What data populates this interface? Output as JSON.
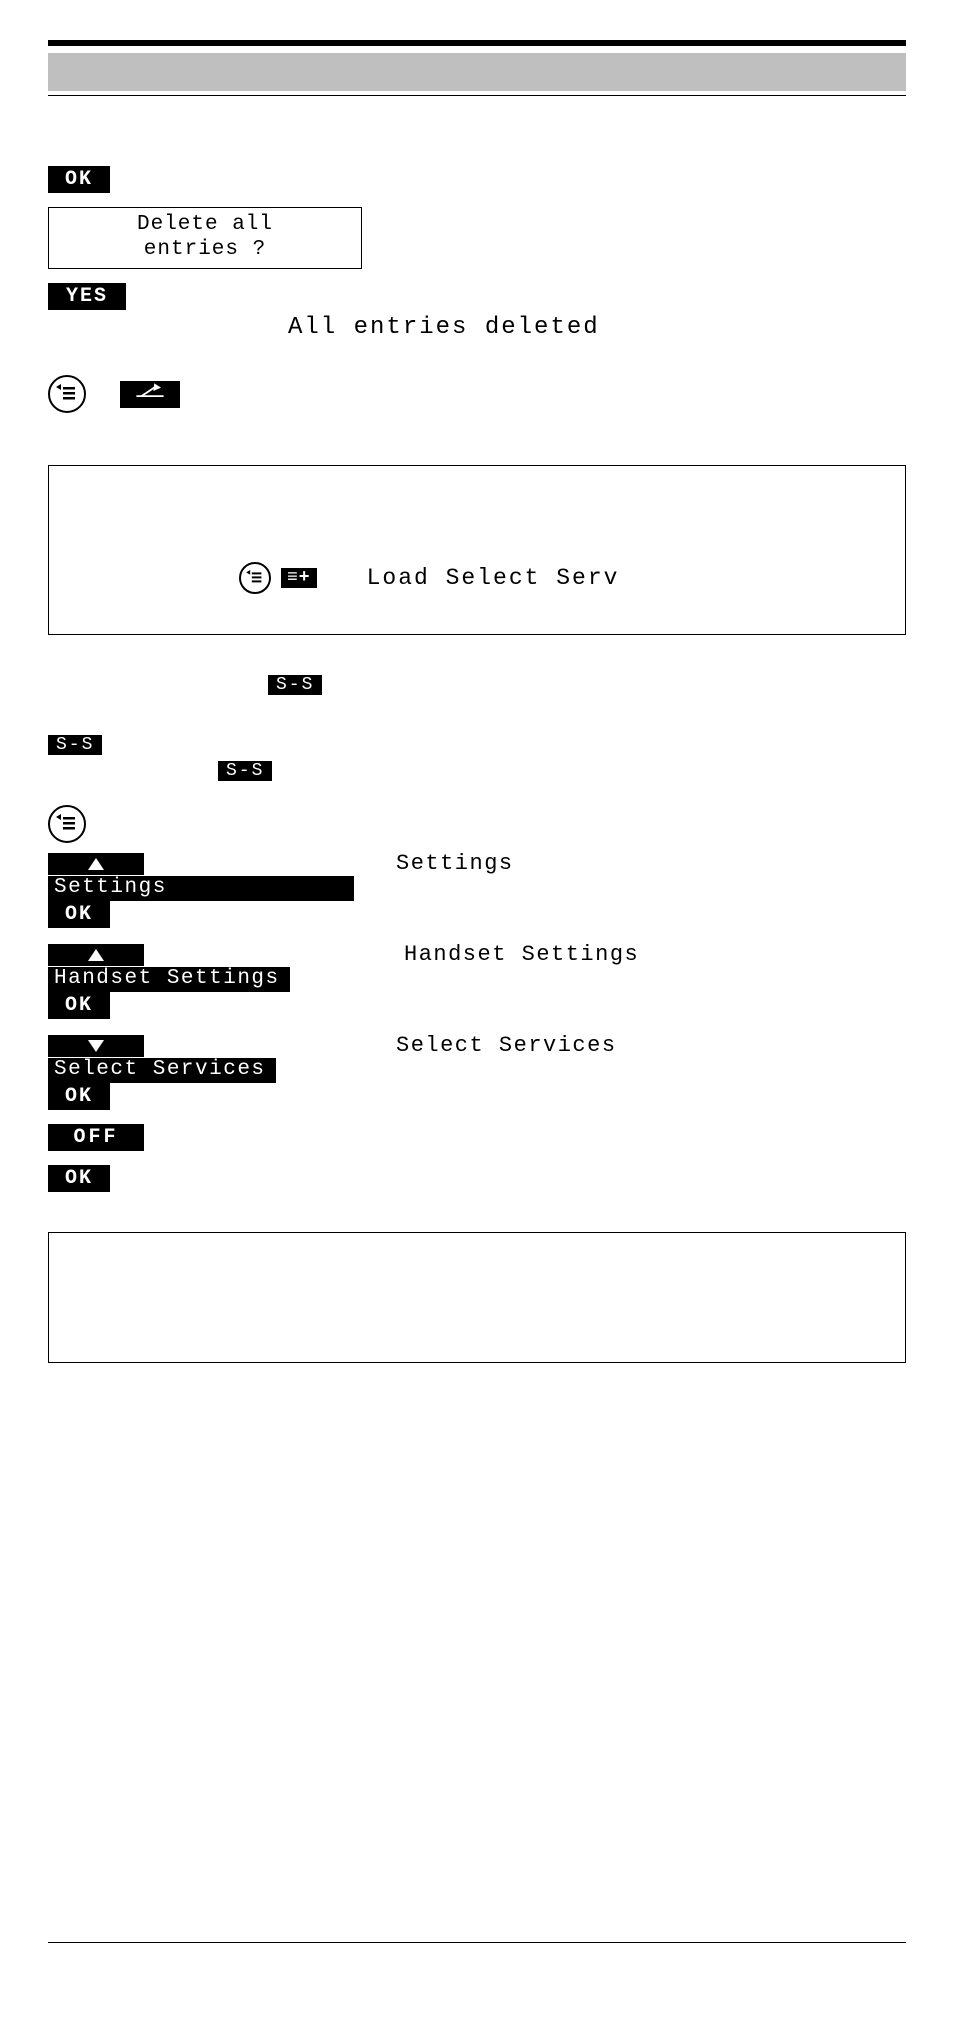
{
  "top": {
    "ok": "OK",
    "dialog_line1": "Delete all",
    "dialog_line2": "entries ?",
    "yes": "YES",
    "status": "All entries deleted"
  },
  "mid_box": {
    "menu_icon_name": "menu-icon",
    "add_label": "≡+",
    "desc": "Load Select Serv"
  },
  "ss": {
    "ss1": "S-S",
    "ss2": "S-S",
    "ss3": "S-S"
  },
  "nav": {
    "menu_icon_name": "menu-icon",
    "up": "▲",
    "down": "▼",
    "settings_label": "Settings",
    "settings_desc": "Settings",
    "handset_label": "Handset Settings",
    "handset_desc": "Handset Settings",
    "select_serv_label": "Select Services",
    "select_serv_desc": "Select Services",
    "ok": "OK",
    "off": "OFF"
  }
}
